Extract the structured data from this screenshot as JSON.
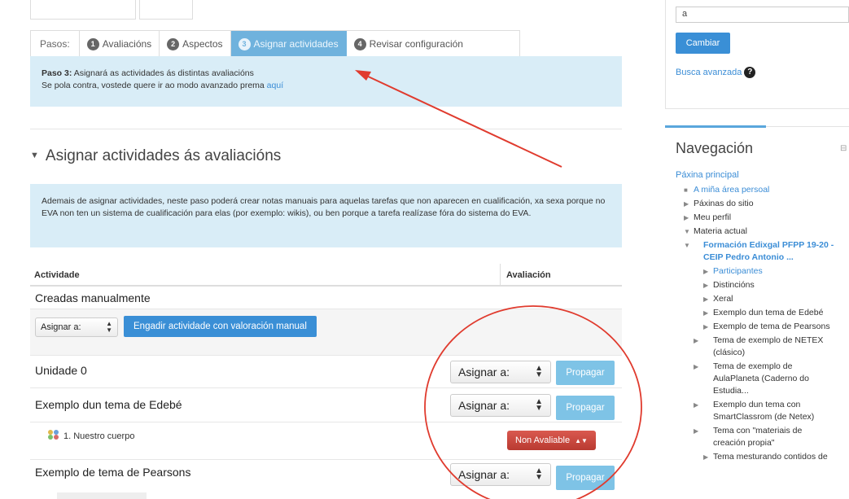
{
  "steps": {
    "label": "Pasos:",
    "items": [
      {
        "num": "1",
        "label": "Avaliacións"
      },
      {
        "num": "2",
        "label": "Aspectos"
      },
      {
        "num": "3",
        "label": "Asignar actividades"
      },
      {
        "num": "4",
        "label": "Revisar configuración"
      }
    ]
  },
  "info1": {
    "strong": "Paso 3:",
    "line1": " Asignará as actividades ás distintas avaliacións",
    "line2": "Se pola contra, vostede quere ir ao modo avanzado prema ",
    "link": "aquí"
  },
  "section": {
    "title": "Asignar actividades ás avaliacións"
  },
  "info2": {
    "text": "Ademais de asignar actividades, neste paso poderá crear notas manuais para aquelas tarefas que non aparecen en cualificación, xa sexa porque no EVA non ten un sistema de cualificación para elas (por exemplo: wikis), ou ben porque a tarefa realízase fóra do sistema do EVA."
  },
  "table": {
    "col_activity": "Actividade",
    "col_evaluation": "Avaliación",
    "manual_title": "Creadas manualmente",
    "assign_label": "Asignar a:",
    "add_manual_btn": "Engadir actividade con valoración manual",
    "propagate": "Propagar",
    "rows": [
      {
        "title": "Unidade 0"
      },
      {
        "title": "Exemplo dun tema de Edebé"
      },
      {
        "title": "Exemplo de tema de Pearsons"
      }
    ],
    "sub_item": "1. Nuestro cuerpo",
    "not_available": "Non Avaliable"
  },
  "sidebar": {
    "search_value": "a",
    "change_btn": "Cambiar",
    "advanced": "Busca avanzada",
    "nav_title": "Navegación",
    "nav": {
      "home": "Páxina principal",
      "my_area": "A miña área persoal",
      "site_pages": "Páxinas do sitio",
      "profile": "Meu perfil",
      "current": "Materia actual",
      "course": "Formación Edixgal PFPP 19-20 - CEIP Pedro Antonio ...",
      "participants": "Participantes",
      "badges": "Distincións",
      "general": "Xeral",
      "i1": "Exemplo dun tema de Edebé",
      "i2": "Exemplo de tema de Pearsons",
      "i3": "Tema de exemplo de NETEX (clásico)",
      "i4": "Tema de exemplo de AulaPlaneta (Caderno do Estudia...",
      "i5": "Exemplo dun tema con SmartClassrom (de Netex)",
      "i6": "Tema con \"materiais de creación propia\"",
      "i7": "Tema mesturando contidos de"
    }
  },
  "colors": {
    "accent": "#3a8fd6",
    "info_bg": "#d9edf7",
    "active_step": "#6fb2dd",
    "annotation": "#e03b2e"
  }
}
